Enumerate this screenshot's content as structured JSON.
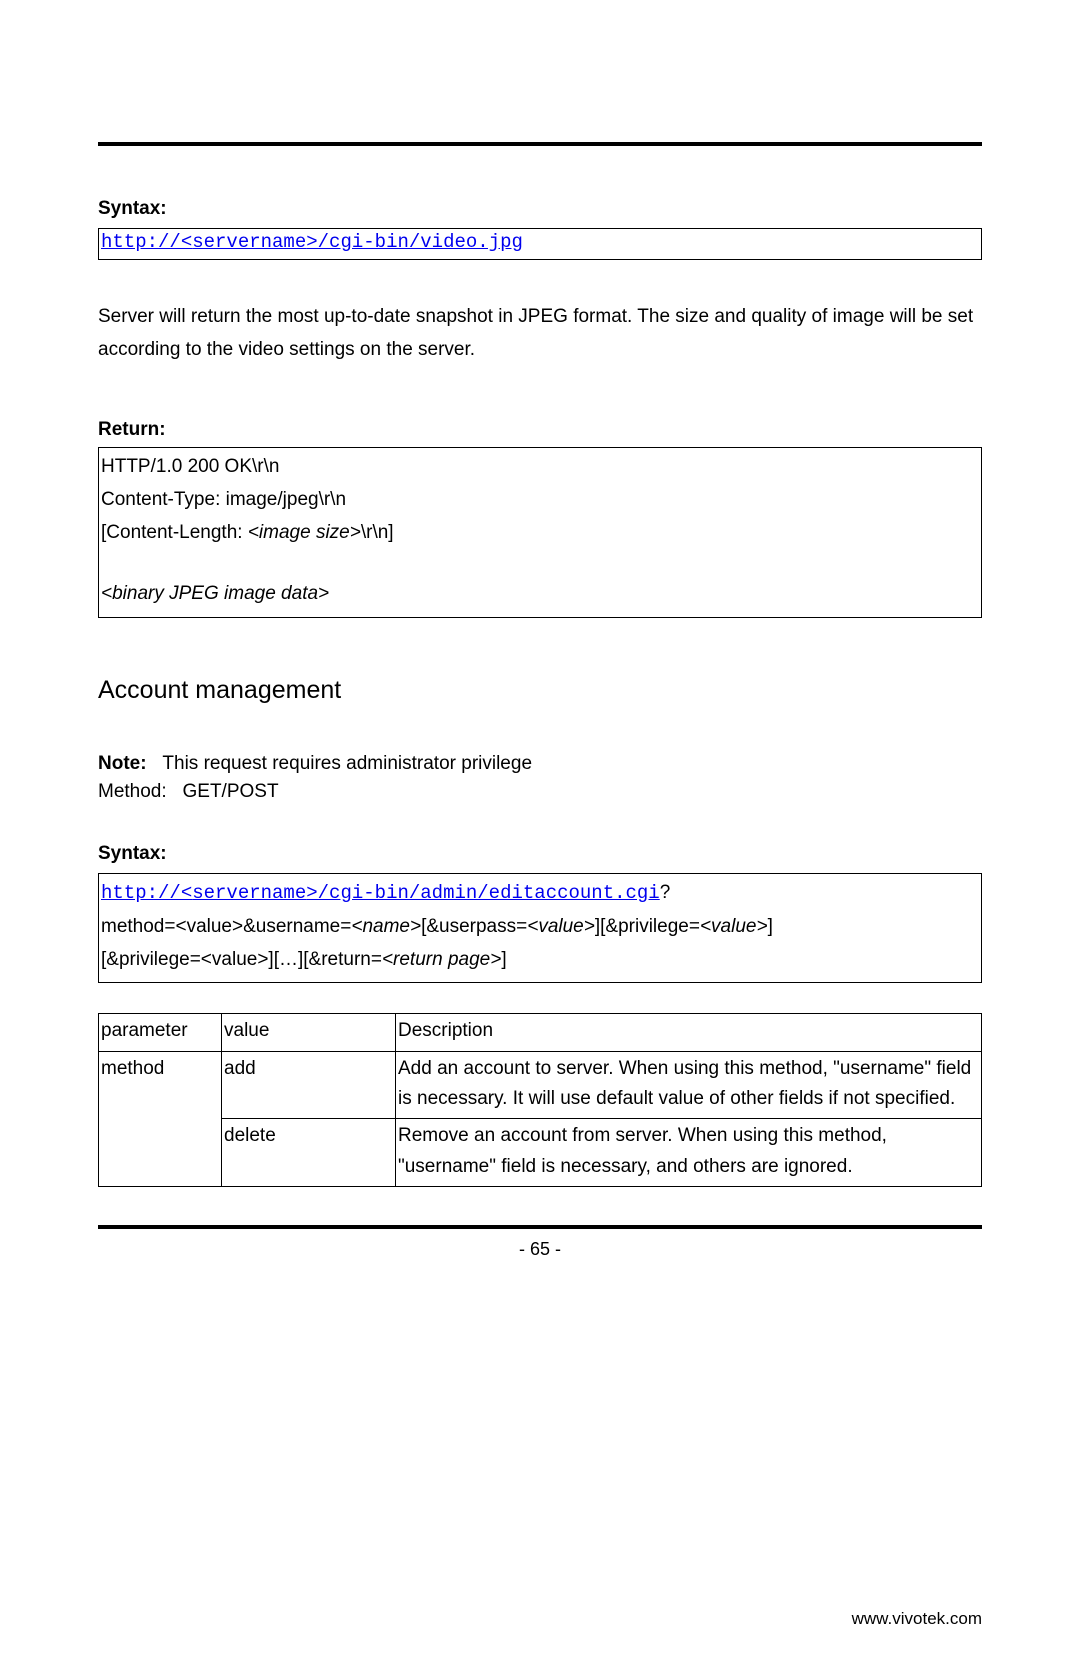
{
  "syntax1": {
    "label": "Syntax:",
    "url_prefix": "http://<",
    "url_servername": "servername",
    "url_suffix": ">/cgi-bin/video.jpg"
  },
  "description": "Server will return the most up-to-date snapshot in JPEG format. The size and quality of image will be set according to the video settings on the server.",
  "return": {
    "label": "Return:",
    "line1": "HTTP/1.0 200 OK\\r\\n",
    "line2": "Content-Type: image/jpeg\\r\\n",
    "line3_prefix": "[Content-Length: ",
    "line3_italic": "<image size>",
    "line3_suffix": "\\r\\n]",
    "line4": "<binary JPEG image data>"
  },
  "heading": "Account management",
  "note": {
    "label": "Note:",
    "text": "This request requires administrator privilege"
  },
  "method": {
    "label": "Method:",
    "value": "GET/POST"
  },
  "syntax2": {
    "label": "Syntax:",
    "url_prefix": "http://<",
    "url_servername": "servername",
    "url_suffix": ">/cgi-bin/admin/editaccount.cgi",
    "qmark": "?",
    "param_line1_a": "method=<value>&username=",
    "param_line1_b": "<name>",
    "param_line1_c": "[&userpass=",
    "param_line1_d": "<value>",
    "param_line1_e": "][&privilege=",
    "param_line1_f": "<value>",
    "param_line1_g": "]",
    "param_line2_a": "[&privilege=<value>][…][&return=",
    "param_line2_b": "<return page>",
    "param_line2_c": "]"
  },
  "table": {
    "headers": {
      "param": "parameter",
      "value": "value",
      "desc": "Description"
    },
    "rows": [
      {
        "param": "method",
        "value": "add",
        "desc": "Add an account to server. When using this method, \"username\" field is necessary. It will use default value of other fields if not specified."
      },
      {
        "param": "",
        "value": "delete",
        "desc": "Remove an account from server. When using this method, \"username\" field is necessary, and others are ignored."
      }
    ]
  },
  "pagenum": "- 65 -",
  "footer": "www.vivotek.com"
}
